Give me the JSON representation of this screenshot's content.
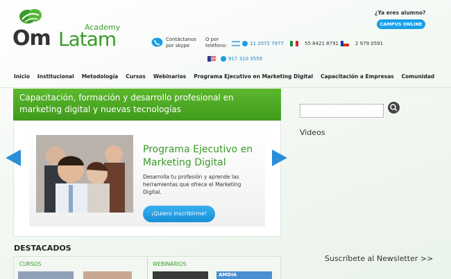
{
  "logo": {
    "om": "Om",
    "latam": "Latam",
    "academy": "Academy"
  },
  "contact": {
    "skype_label": "Contáctanos por skype",
    "phone_label": "O por teléfono:",
    "numbers": [
      {
        "country": "Argentina",
        "number": "11 2072 7977"
      },
      {
        "country": "Mexico",
        "number": "55 8421 8791"
      },
      {
        "country": "Chile",
        "number": "2 979 0591"
      },
      {
        "country": "USA",
        "number": "917 310 3559"
      }
    ]
  },
  "student": {
    "question": "¿Ya eres alumno?",
    "campus_button": "CAMPUS ONLINE"
  },
  "nav": [
    "Inicio",
    "Institucional",
    "Metodología",
    "Cursos",
    "Webinarios",
    "Programa Ejecutivo en Marketing Digital",
    "Capacitación a Empresas",
    "Comunidad"
  ],
  "banner": {
    "text": "Capacitación, formación y desarrollo profesional en marketing digital y nuevas tecnologías"
  },
  "slide": {
    "title": "Programa Ejecutivo en Marketing Digital",
    "description": "Desarrolla tu profesión y aprende las herramientas que ofrece el Marketing Digital.",
    "button": "¡Quiero inscribirme!"
  },
  "featured": {
    "heading": "DESTACADOS",
    "col1": "CURSOS",
    "col2": "WEBINARIOS",
    "amdia": "AMDIA"
  },
  "sidebar": {
    "search_placeholder": "",
    "videos": "Videos",
    "newsletter": "Suscríbete al Newsletter >>"
  },
  "colors": {
    "brand_green": "#3a9a2a",
    "accent_blue": "#1aa0e8",
    "banner_green": "#4fa824"
  }
}
